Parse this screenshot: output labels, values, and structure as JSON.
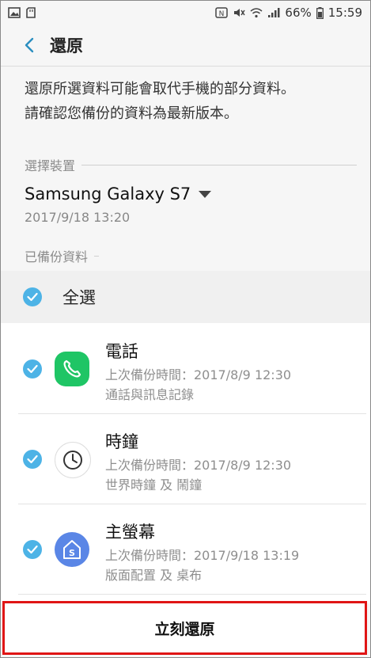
{
  "status_bar": {
    "battery": "66%",
    "time": "15:59"
  },
  "app_bar": {
    "title": "還原"
  },
  "intro": {
    "line1": "還原所選資料可能會取代手機的部分資料。",
    "line2": "請確認您備份的資料為最新版本。"
  },
  "device_section": {
    "header": "選擇裝置",
    "device_name": "Samsung Galaxy S7",
    "date": "2017/9/18 13:20"
  },
  "backup_section": {
    "header": "已備份資料",
    "select_all": "全選",
    "items": [
      {
        "title": "電話",
        "last_backup": "上次備份時間：2017/8/9 12:30",
        "details": "通話與訊息記錄",
        "icon": "phone-icon",
        "color": "#1fc565"
      },
      {
        "title": "時鐘",
        "last_backup": "上次備份時間：2017/8/9 12:30",
        "details": "世界時鐘 及 鬧鐘",
        "icon": "clock-icon",
        "color": "#ffffff"
      },
      {
        "title": "主螢幕",
        "last_backup": "上次備份時間：2017/9/18 13:19",
        "details": "版面配置 及 桌布",
        "icon": "home-screen-icon",
        "color": "#5a86e6"
      }
    ]
  },
  "bottom_button": {
    "label": "立刻還原"
  },
  "colors": {
    "accent": "#4db3e6",
    "highlight_border": "#e01515"
  }
}
